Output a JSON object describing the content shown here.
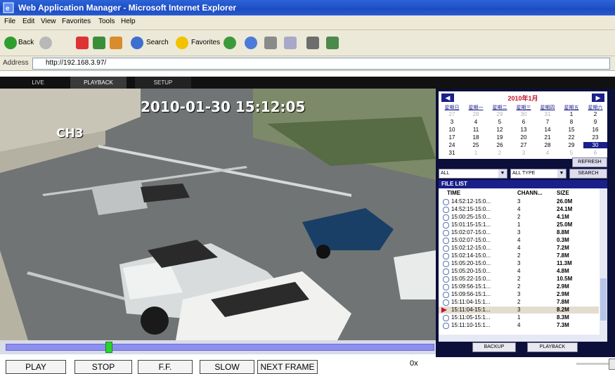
{
  "window": {
    "title": "Web Application Manager - Microsoft Internet Explorer"
  },
  "menu": [
    "File",
    "Edit",
    "View",
    "Favorites",
    "Tools",
    "Help"
  ],
  "toolbar": {
    "back": "Back",
    "search": "Search",
    "favorites": "Favorites"
  },
  "address": {
    "label": "Address",
    "url": "http://192.168.3.97/"
  },
  "tabs": [
    "LIVE",
    "PLAYBACK",
    "SETUP"
  ],
  "video": {
    "timestamp": "2010-01-30  15:12:05",
    "channel": "CH3"
  },
  "playback_position": 0.24,
  "controls": {
    "play": "PLAY",
    "stop": "STOP",
    "ff": "F.F.",
    "slow": "SLOW",
    "next_frame": "NEXT FRAME",
    "speed": "0x"
  },
  "calendar": {
    "month_label": "2010年1月",
    "weekdays": [
      "星期日",
      "星期一",
      "星期二",
      "星期三",
      "星期四",
      "星期五",
      "星期六"
    ],
    "weeks": [
      [
        "27",
        "28",
        "29",
        "30",
        "31",
        "1",
        "2"
      ],
      [
        "3",
        "4",
        "5",
        "6",
        "7",
        "8",
        "9"
      ],
      [
        "10",
        "11",
        "12",
        "13",
        "14",
        "15",
        "16"
      ],
      [
        "17",
        "18",
        "19",
        "20",
        "21",
        "22",
        "23"
      ],
      [
        "24",
        "25",
        "26",
        "27",
        "28",
        "29",
        "30"
      ],
      [
        "31",
        "1",
        "2",
        "3",
        "4",
        "5",
        "6"
      ]
    ],
    "selected_day": "30",
    "refresh": "REFRESH"
  },
  "filter": {
    "channel": "ALL",
    "type": "ALL TYPE",
    "search": "SEARCH"
  },
  "file_list": {
    "title": "FILE LIST",
    "columns": [
      "TIME",
      "CHANN...",
      "SIZE"
    ],
    "rows": [
      {
        "time": "14:52:12-15:0...",
        "ch": "3",
        "size": "26.0M"
      },
      {
        "time": "14:52:15-15:0...",
        "ch": "4",
        "size": "24.1M"
      },
      {
        "time": "15:00:25-15:0...",
        "ch": "2",
        "size": "4.1M"
      },
      {
        "time": "15:01:15-15:1...",
        "ch": "1",
        "size": "25.0M"
      },
      {
        "time": "15:02:07-15:0...",
        "ch": "3",
        "size": "8.8M"
      },
      {
        "time": "15:02:07-15:0...",
        "ch": "4",
        "size": "0.3M"
      },
      {
        "time": "15:02:12-15:0...",
        "ch": "4",
        "size": "7.2M"
      },
      {
        "time": "15:02:14-15:0...",
        "ch": "2",
        "size": "7.8M"
      },
      {
        "time": "15:05:20-15:0...",
        "ch": "3",
        "size": "11.3M"
      },
      {
        "time": "15:05:20-15:0...",
        "ch": "4",
        "size": "4.8M"
      },
      {
        "time": "15:05:22-15:0...",
        "ch": "2",
        "size": "10.5M"
      },
      {
        "time": "15:09:56-15:1...",
        "ch": "2",
        "size": "2.9M"
      },
      {
        "time": "15:09:56-15:1...",
        "ch": "3",
        "size": "2.9M"
      },
      {
        "time": "15:11:04-15:1...",
        "ch": "2",
        "size": "7.8M"
      },
      {
        "time": "15:11:04-15:1...",
        "ch": "3",
        "size": "8.2M"
      },
      {
        "time": "15:11:05-15:1...",
        "ch": "1",
        "size": "8.3M"
      },
      {
        "time": "15:11:10-15:1...",
        "ch": "4",
        "size": "7.3M"
      }
    ],
    "selected_index": 14,
    "backup": "BACKUP",
    "playback": "PLAYBACK"
  },
  "colors": {
    "app_bg": "#0b0f3a",
    "accent": "#1a1f8a",
    "timeline": "#8c8ef0",
    "knob": "#2cd32c"
  }
}
